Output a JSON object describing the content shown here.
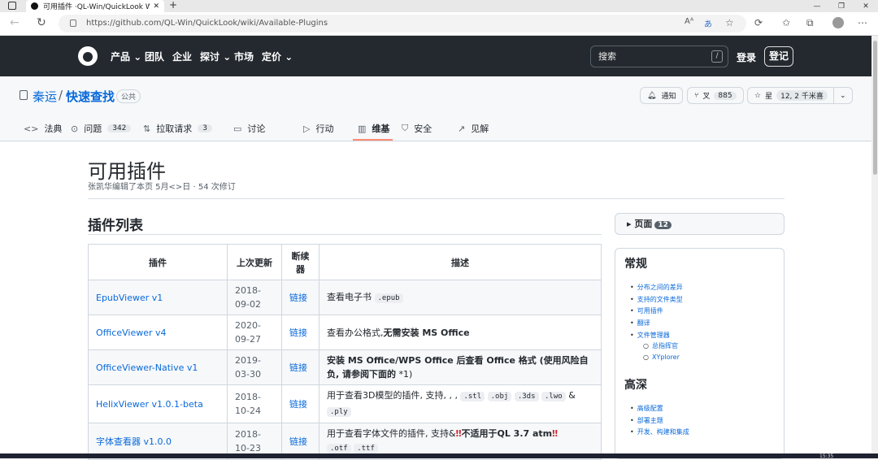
{
  "browser": {
    "tab_title": "可用插件 ·QL-Win/QuickLook Wi",
    "url": "https://github.com/QL-Win/QuickLook/wiki/Available-Plugins",
    "clock": "15:35"
  },
  "github_nav": {
    "items": [
      "产品",
      "团队",
      "企业",
      "探讨",
      "市场",
      "定价"
    ],
    "search_placeholder": "搜索",
    "search_shortcut": "/",
    "login": "登录",
    "signup": "登记"
  },
  "repo": {
    "owner": "秦运",
    "name": "快速查找",
    "visibility": "公共",
    "notifications_label": "通知",
    "fork_label": "叉",
    "fork_count": "885",
    "star_label": "星",
    "star_count": "12, 2 千米喜"
  },
  "repo_tabs": [
    {
      "label": "法典",
      "icon": "code-icon",
      "count": ""
    },
    {
      "label": "问题",
      "icon": "issue-icon",
      "count": "342"
    },
    {
      "label": "拉取请求",
      "icon": "pull-request-icon",
      "count": "3"
    },
    {
      "label": "讨论",
      "icon": "discussion-icon",
      "count": ""
    },
    {
      "label": "行动",
      "icon": "play-icon",
      "count": ""
    },
    {
      "label": "维基",
      "icon": "book-icon",
      "count": ""
    },
    {
      "label": "安全",
      "icon": "shield-icon",
      "count": ""
    },
    {
      "label": "见解",
      "icon": "graph-icon",
      "count": ""
    }
  ],
  "wiki": {
    "title": "可用插件",
    "meta": "张凯华编辑了本页 5月<>日 · 54 次修订",
    "section_heading": "插件列表",
    "table": {
      "headers": [
        "插件",
        "上次更新",
        "断续器",
        "描述"
      ],
      "rows": [
        {
          "name": "EpubViewer v1",
          "updated": "2018-09-02",
          "link": "链接"
        },
        {
          "name": "OfficeViewer v4",
          "updated": "2020-09-27",
          "link": "链接"
        },
        {
          "name": "OfficeViewer-Native v1",
          "updated": "2019-03-30",
          "link": "链接"
        },
        {
          "name": "HelixViewer v1.0.1-beta",
          "updated": "2018-10-24",
          "link": "链接"
        },
        {
          "name": "字体查看器 v1.0.0",
          "updated": "2018-10-23",
          "link": "链接"
        }
      ],
      "desc": {
        "r1_text": "查看电子书",
        "r1_code": ".epub",
        "r2_text": "查看办公格式,",
        "r2_bold": "无需安装 MS Office",
        "r3_bold": "安装 MS Office/WPS Office 后查看 Office 格式 (使用风险自负, 请参阅下面的",
        "r3_tail": " *1)",
        "r4_text": "用于查看3D模型的插件, 支持, , ,",
        "r4_codes": [
          ".stl",
          ".obj",
          ".3ds",
          ".lwo"
        ],
        "r4_amp": "&",
        "r4_last": ".ply",
        "r5_text": "用于查看字体文件的插件, 支持&",
        "r5_warn": "‼",
        "r5_bold": "不适用于QL 3.7 atm",
        "r5_codes": [
          ".otf",
          ".ttf"
        ]
      }
    }
  },
  "sidebar": {
    "pages_label": "页面",
    "pages_count": "12",
    "sections": [
      {
        "heading": "常规",
        "links": [
          "分布之间的差异",
          "支持的文件类型",
          "可用插件",
          "翻译",
          "文件管理器"
        ],
        "sublinks": [
          "总指挥官",
          "XYplorer"
        ]
      },
      {
        "heading": "高深",
        "links": [
          "高级配置",
          "部署主题",
          "开发、构建和集成"
        ],
        "sublinks": []
      }
    ]
  }
}
